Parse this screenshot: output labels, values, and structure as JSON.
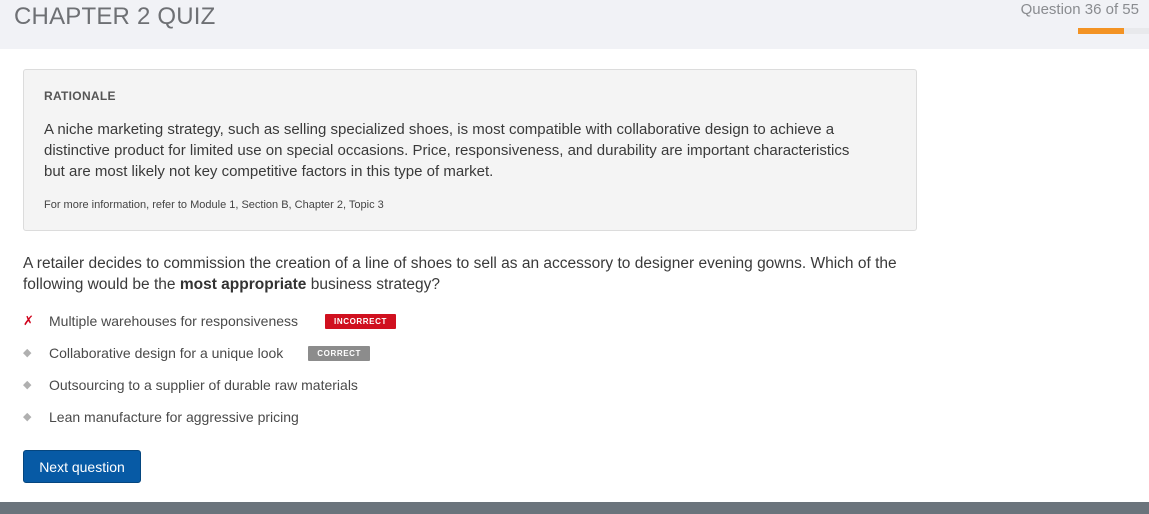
{
  "header": {
    "title": "CHAPTER 2 QUIZ",
    "progress_text": "Question 36 of 55",
    "progress_fraction": 0.6545,
    "progress_color": "#f39324"
  },
  "rationale": {
    "heading": "RATIONALE",
    "body": "A niche marketing strategy, such as selling specialized shoes, is most compatible with collaborative design to achieve a distinctive product for limited use on special occasions. Price, responsiveness, and durability are important characteristics but are most likely not key competitive factors in this type of market.",
    "reference": "For more information, refer to Module 1, Section B, Chapter 2, Topic 3"
  },
  "question": {
    "text_before": "A retailer decides to commission the creation of a line of shoes to sell as an accessory to designer evening gowns. Which of the following would be the ",
    "text_bold": "most appropriate",
    "text_after": " business strategy?"
  },
  "answers": [
    {
      "text": "Multiple warehouses for responsiveness",
      "marker": "✗",
      "marker_icon": "cross-icon",
      "badge": "INCORRECT"
    },
    {
      "text": "Collaborative design for a unique look",
      "marker": "◆",
      "marker_icon": "diamond-bullet-icon",
      "badge": "CORRECT"
    },
    {
      "text": "Outsourcing to a supplier of durable raw materials",
      "marker": "◆",
      "marker_icon": "diamond-bullet-icon",
      "badge": ""
    },
    {
      "text": "Lean manufacture for aggressive pricing",
      "marker": "◆",
      "marker_icon": "diamond-bullet-icon",
      "badge": ""
    }
  ],
  "actions": {
    "next_label": "Next question"
  },
  "colors": {
    "incorrect_badge": "#d0101f",
    "correct_badge": "#8c8c8c",
    "next_button": "#075aa5"
  }
}
